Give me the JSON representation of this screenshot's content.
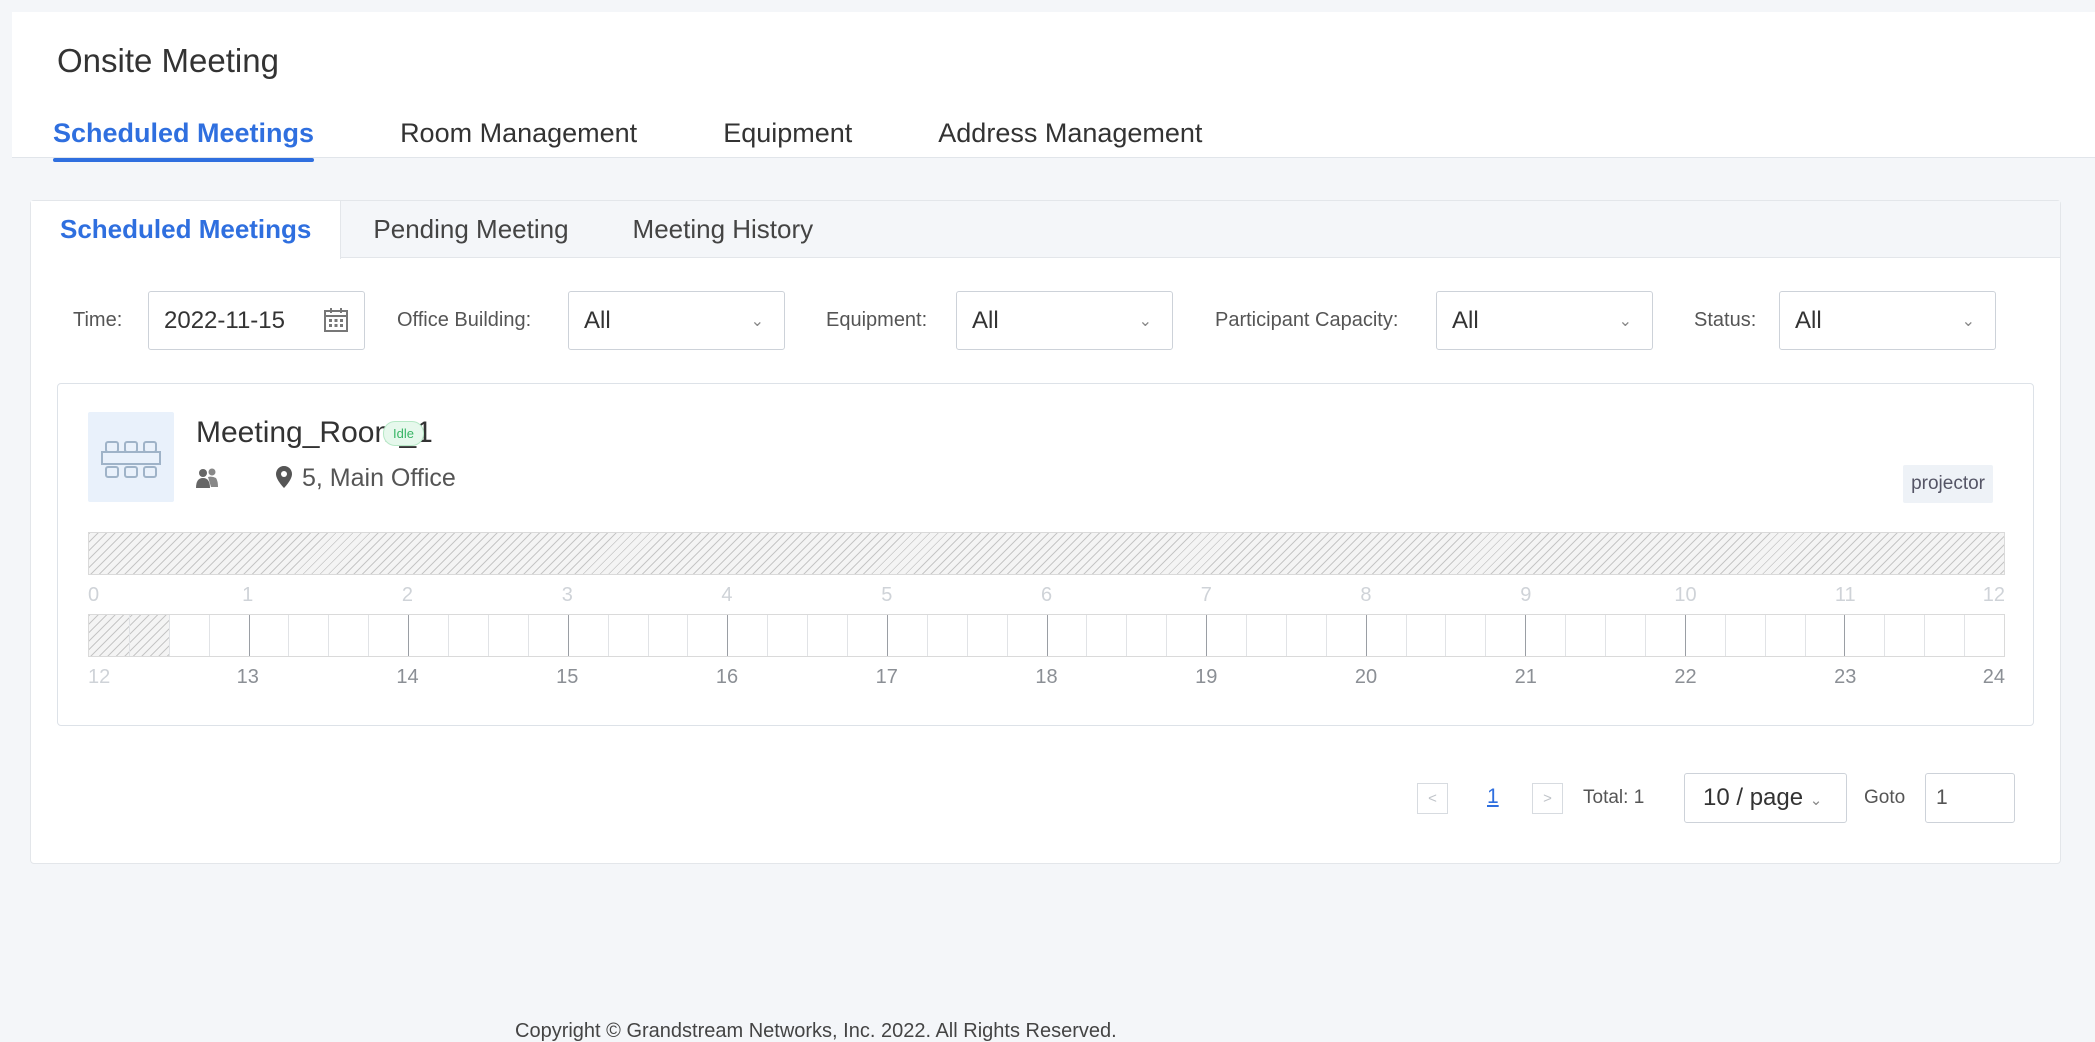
{
  "header": {
    "title": "Onsite Meeting",
    "tabs": [
      {
        "label": "Scheduled Meetings",
        "active": true
      },
      {
        "label": "Room Management",
        "active": false
      },
      {
        "label": "Equipment",
        "active": false
      },
      {
        "label": "Address Management",
        "active": false
      }
    ]
  },
  "subtabs": [
    {
      "label": "Scheduled Meetings",
      "active": true
    },
    {
      "label": "Pending Meeting",
      "active": false
    },
    {
      "label": "Meeting History",
      "active": false
    }
  ],
  "filters": {
    "time_label": "Time:",
    "time_value": "2022-11-15",
    "building_label": "Office Building:",
    "building_value": "All",
    "equipment_label": "Equipment:",
    "equipment_value": "All",
    "capacity_label": "Participant Capacity:",
    "capacity_value": "All",
    "status_label": "Status:",
    "status_value": "All"
  },
  "room": {
    "name": "Meeting_Room_1",
    "status": "Idle",
    "location": "5, Main Office",
    "equipment_tag": "projector",
    "timeline_am_labels": [
      "0",
      "1",
      "2",
      "3",
      "4",
      "5",
      "6",
      "7",
      "8",
      "9",
      "10",
      "11",
      "12"
    ],
    "timeline_pm_labels": [
      "12",
      "13",
      "14",
      "15",
      "16",
      "17",
      "18",
      "19",
      "20",
      "21",
      "22",
      "23",
      "24"
    ],
    "am_unavailable_fraction": 1.0,
    "pm_unavailable_fraction": 0.04167
  },
  "pagination": {
    "prev": "<",
    "current_page": "1",
    "next": ">",
    "total": "Total: 1",
    "page_size": "10 / page",
    "goto_label": "Goto",
    "goto_value": "1"
  },
  "footer": {
    "copyright": "Copyright © Grandstream Networks, Inc. 2022. All Rights Reserved."
  },
  "colors": {
    "accent": "#2f6fdf",
    "status_idle": "#39b566"
  }
}
